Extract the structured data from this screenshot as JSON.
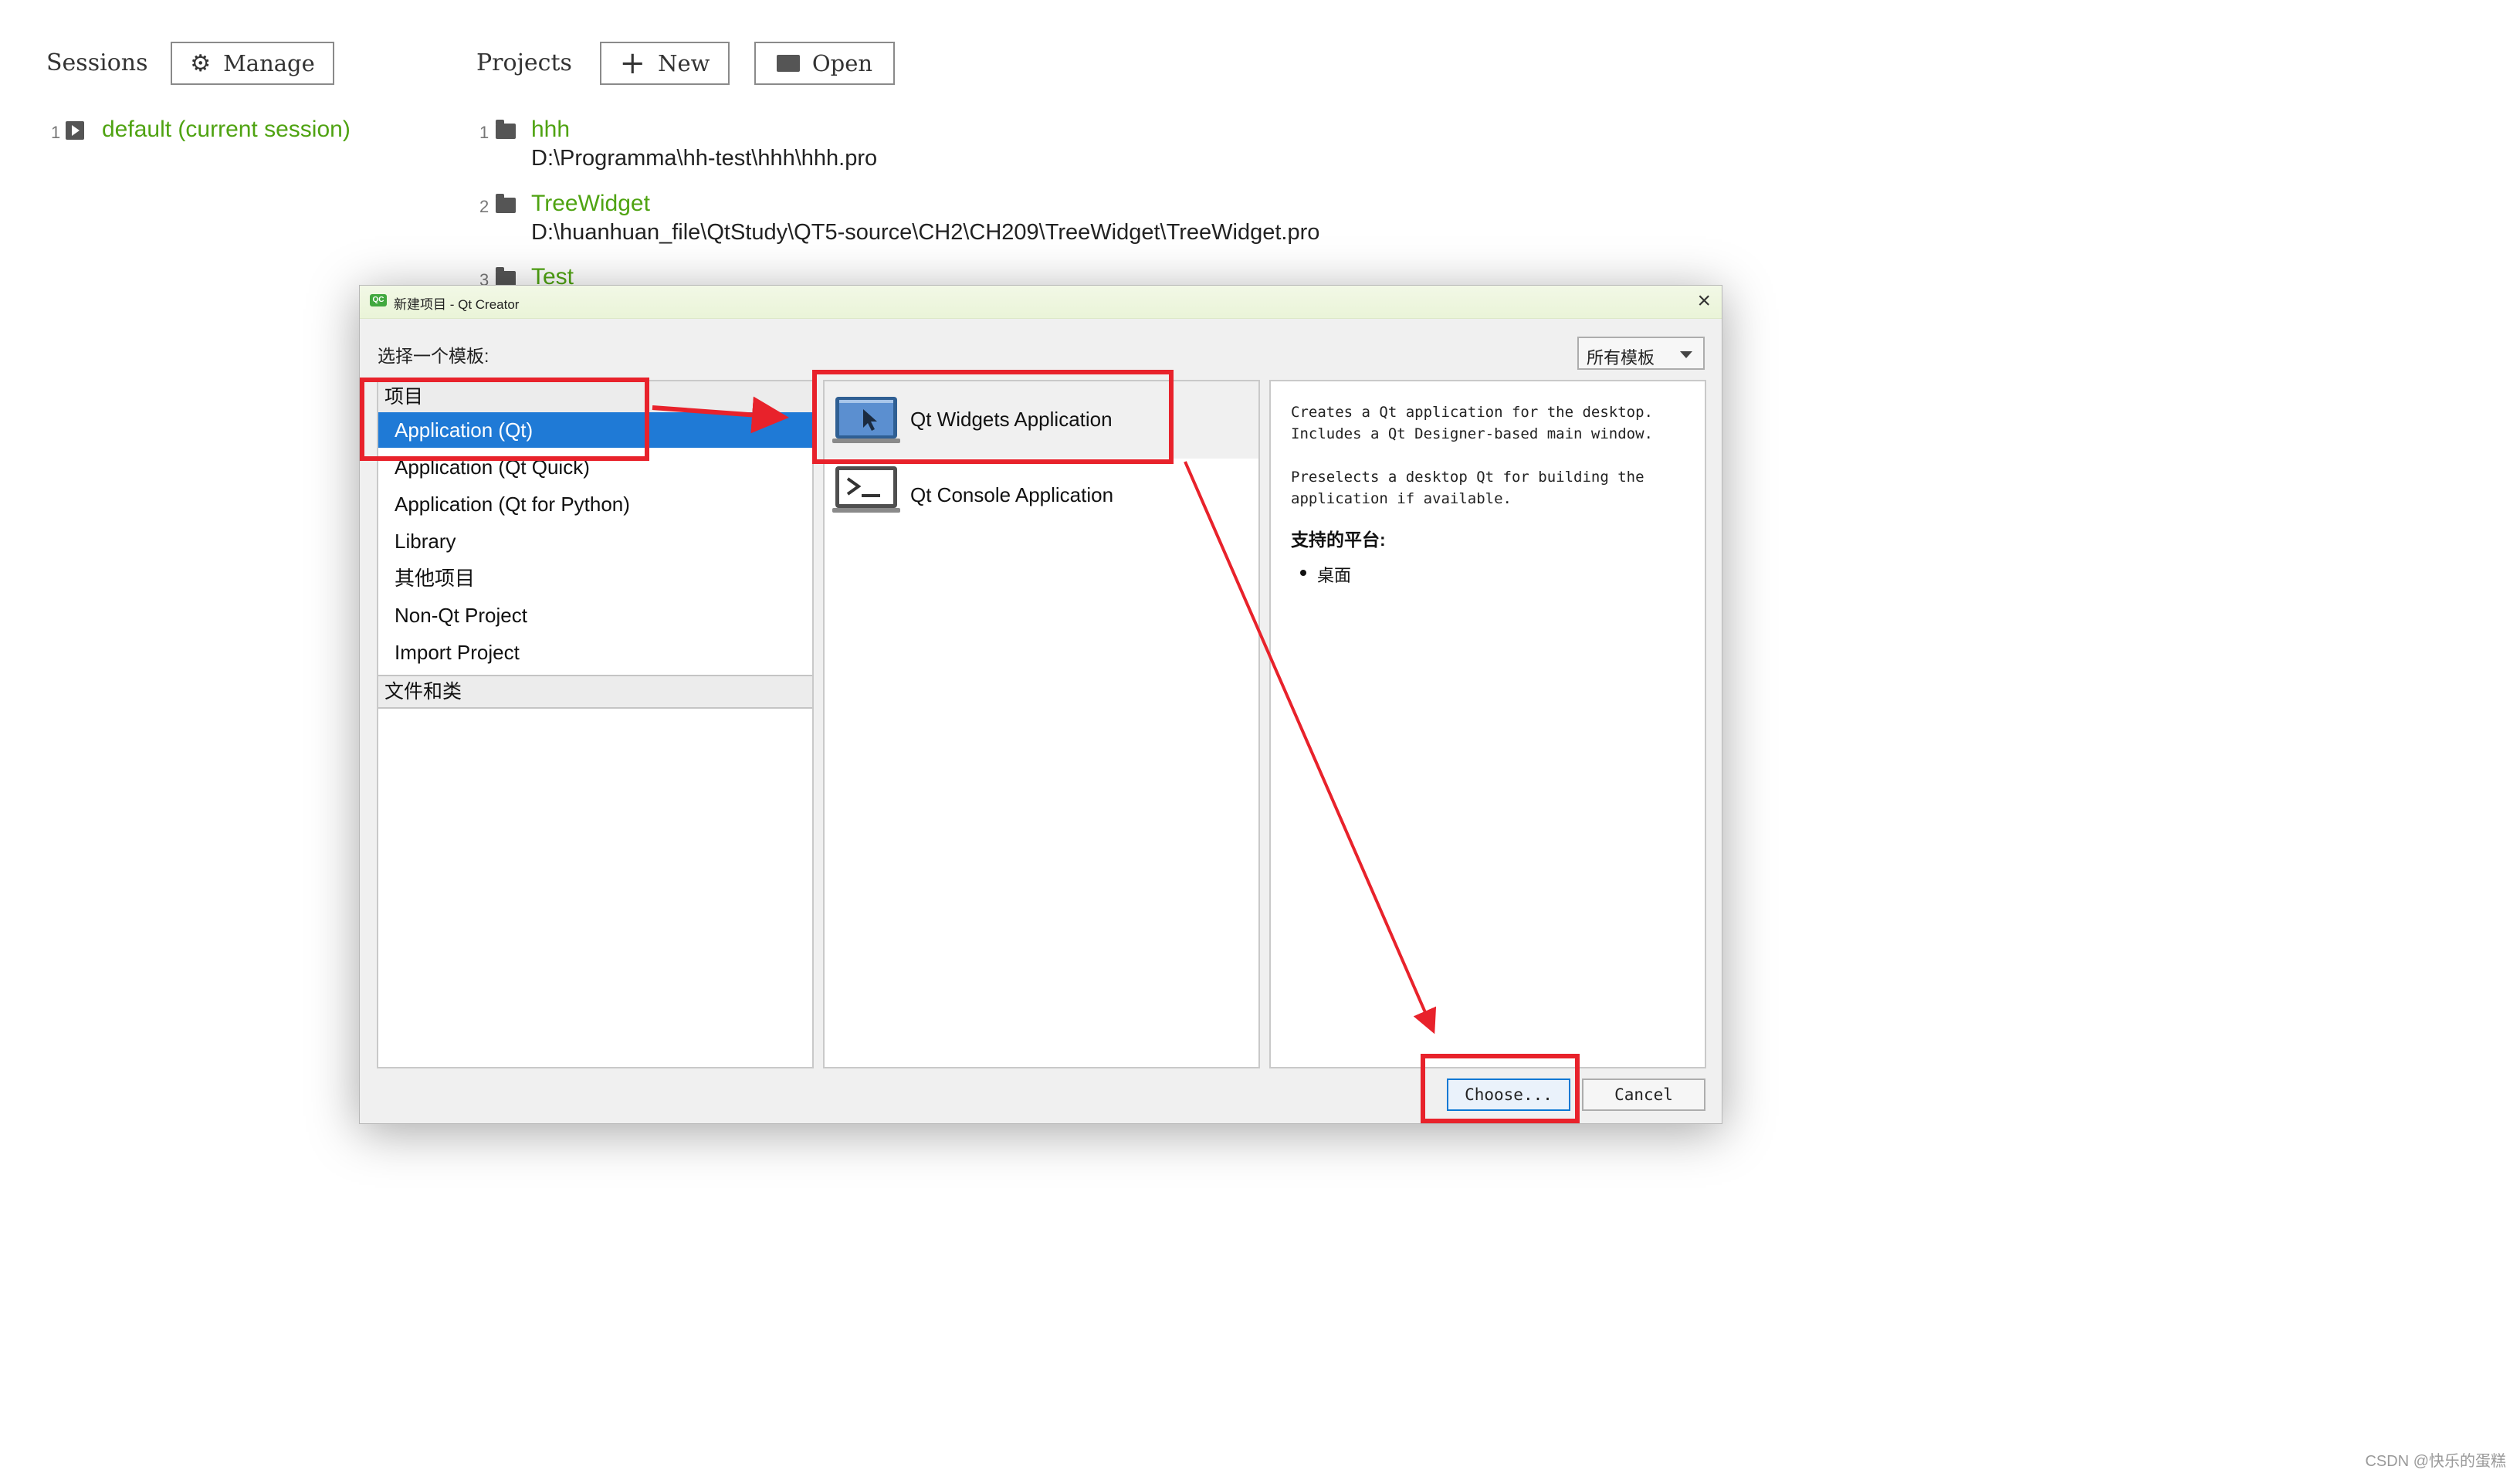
{
  "sessions": {
    "title": "Sessions",
    "manage_label": "Manage",
    "items": [
      {
        "index": "1",
        "label": "default (current session)"
      }
    ]
  },
  "projects": {
    "title": "Projects",
    "new_label": "New",
    "open_label": "Open",
    "items": [
      {
        "index": "1",
        "name": "hhh",
        "path": "D:\\Programma\\hh-test\\hhh\\hhh.pro"
      },
      {
        "index": "2",
        "name": "TreeWidget",
        "path": "D:\\huanhuan_file\\QtStudy\\QT5-source\\CH2\\CH209\\TreeWidget\\TreeWidget.pro"
      },
      {
        "index": "3",
        "name": "Test",
        "path": ""
      }
    ]
  },
  "dialog": {
    "title": "新建项目 - Qt Creator",
    "app_icon_text": "QC",
    "subtitle": "选择一个模板:",
    "filter_value": "所有模板",
    "categories": {
      "header_projects": "项目",
      "items": [
        "Application (Qt)",
        "Application (Qt Quick)",
        "Application (Qt for Python)",
        "Library",
        "其他项目",
        "Non-Qt Project",
        "Import Project"
      ],
      "selected_index": 0,
      "header_files": "文件和类"
    },
    "templates": [
      {
        "label": "Qt Widgets Application",
        "icon": "qt-widgets-app-icon",
        "selected": true
      },
      {
        "label": "Qt Console Application",
        "icon": "console-app-icon",
        "selected": false
      }
    ],
    "description": {
      "text": "Creates a Qt application for the desktop.\nIncludes a Qt Designer-based main window.\n\nPreselects a desktop Qt for building the\napplication if available.",
      "platforms_title": "支持的平台:",
      "platforms": [
        "桌面"
      ]
    },
    "buttons": {
      "choose": "Choose...",
      "cancel": "Cancel"
    }
  },
  "annotation_color": "#e8222b",
  "selection_color": "#1f7ad6",
  "link_color": "#4fa312",
  "watermark": "CSDN @快乐的蛋糕"
}
